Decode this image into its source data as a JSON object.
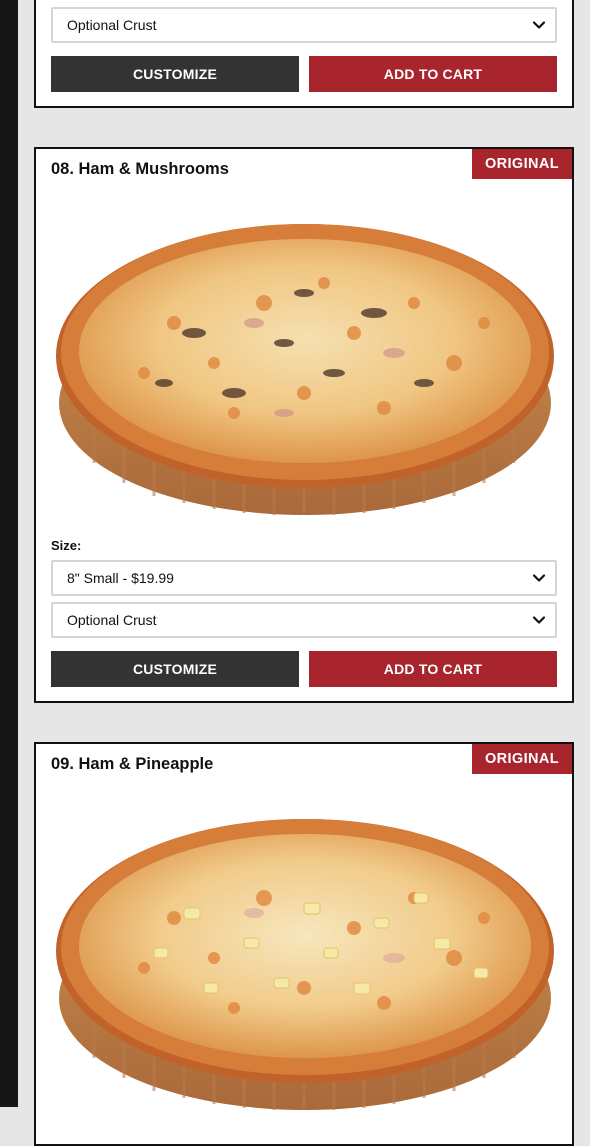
{
  "colors": {
    "brand_red": "#a8252d",
    "button_dark": "#333333",
    "background": "#e6e6e6"
  },
  "top_card": {
    "crust_select": {
      "value": "Optional Crust"
    },
    "customize_label": "CUSTOMIZE",
    "add_to_cart_label": "ADD TO CART"
  },
  "products": [
    {
      "title": "08. Ham & Mushrooms",
      "badge": "ORIGINAL",
      "image_icon": "pizza-ham-mushrooms-image",
      "size_label": "Size:",
      "size_select": {
        "value": "8\" Small - $19.99"
      },
      "crust_select": {
        "value": "Optional Crust"
      },
      "customize_label": "CUSTOMIZE",
      "add_to_cart_label": "ADD TO CART"
    },
    {
      "title": "09. Ham & Pineapple",
      "badge": "ORIGINAL",
      "image_icon": "pizza-ham-pineapple-image"
    }
  ]
}
